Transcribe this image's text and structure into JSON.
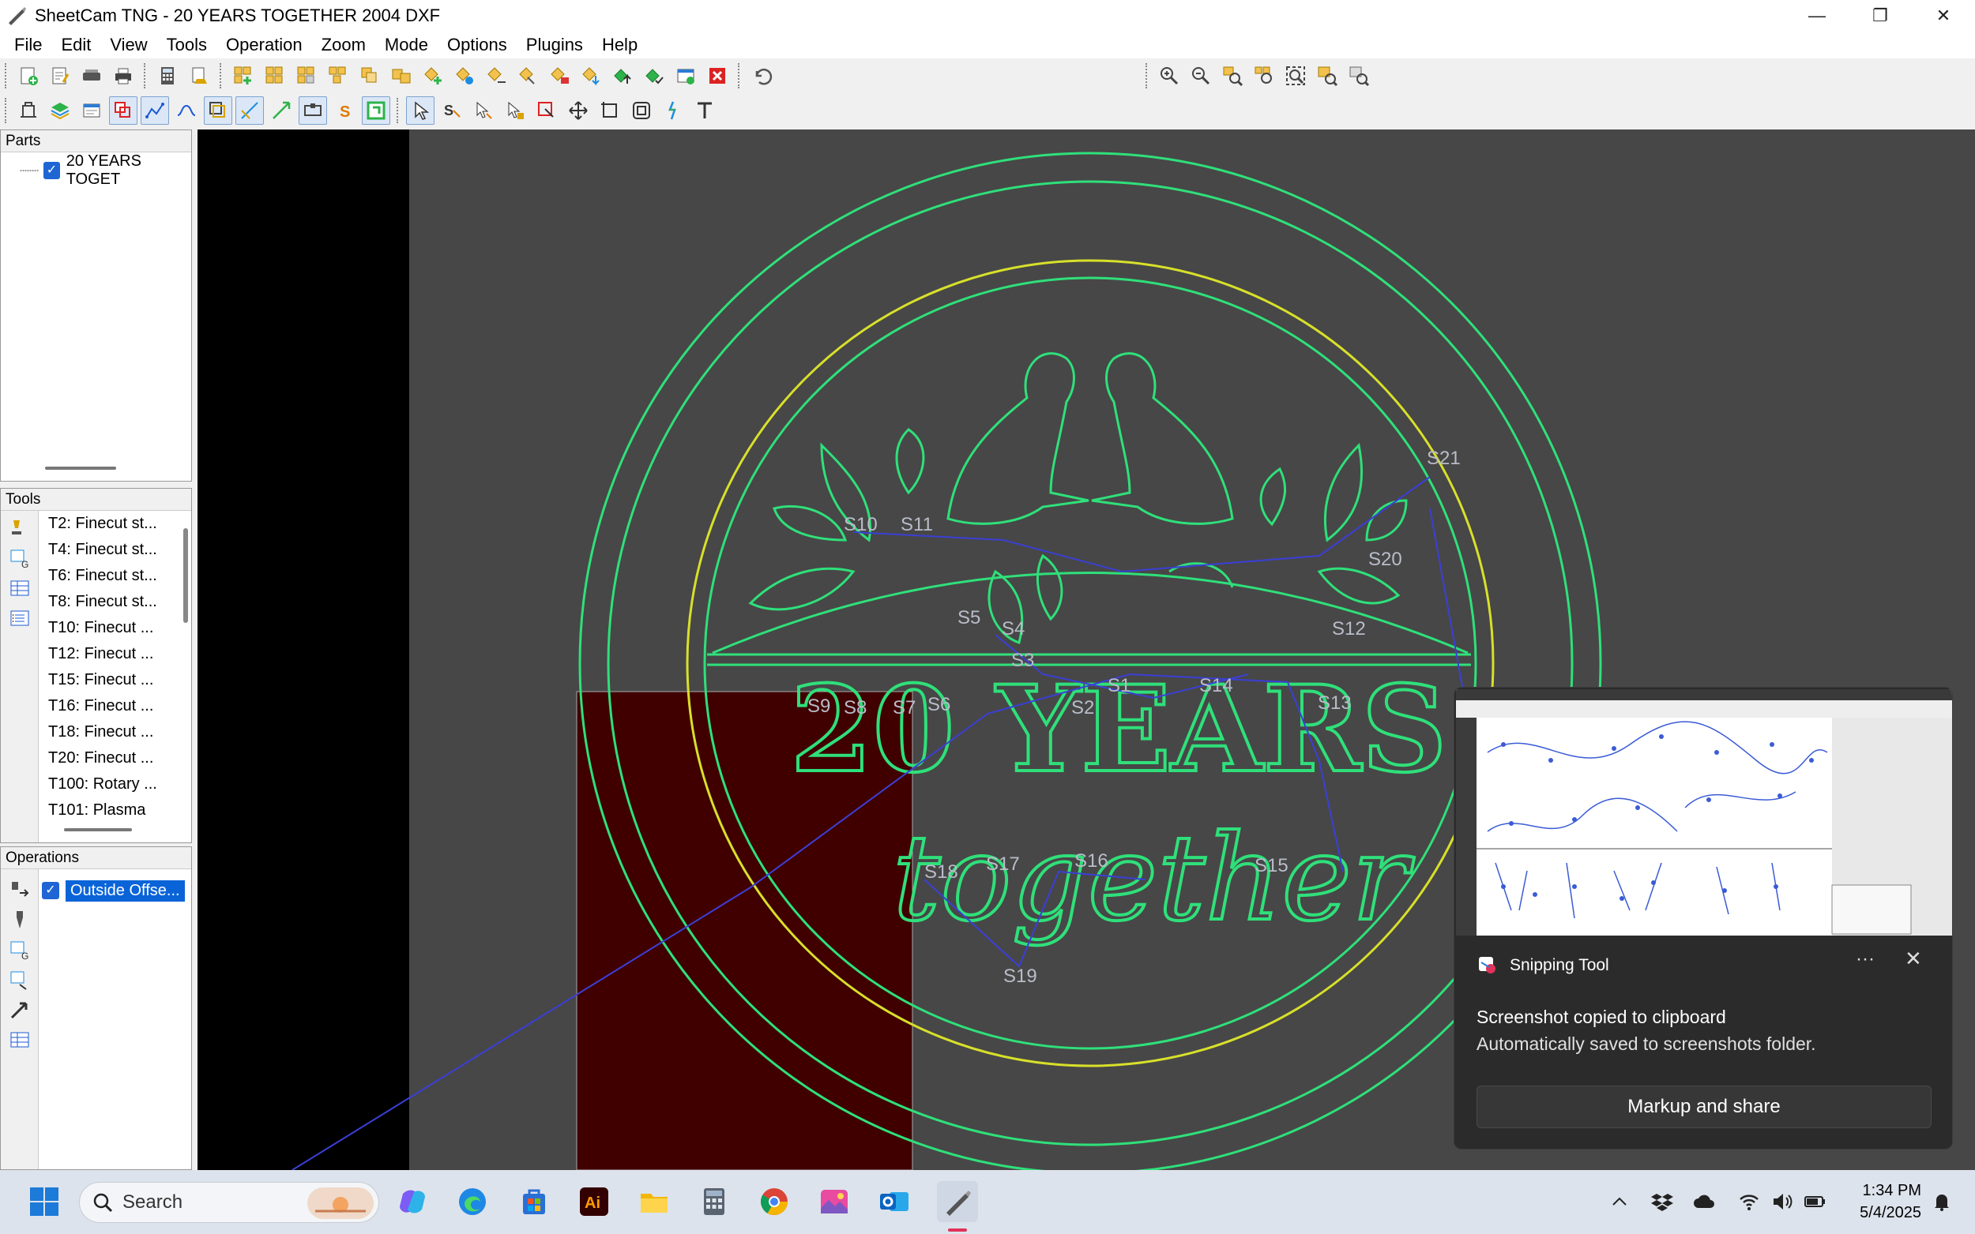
{
  "window": {
    "title": "SheetCam TNG - 20 YEARS TOGETHER 2004 DXF",
    "minimize": "—",
    "maximize": "❐",
    "close": "✕"
  },
  "menu": [
    "File",
    "Edit",
    "View",
    "Tools",
    "Operation",
    "Zoom",
    "Mode",
    "Options",
    "Plugins",
    "Help"
  ],
  "parts_panel": {
    "header": "Parts",
    "items": [
      {
        "label": "20 YEARS TOGET",
        "checked": true
      }
    ]
  },
  "tools_panel": {
    "header": "Tools",
    "items": [
      "T2: Finecut st...",
      "T4: Finecut st...",
      "T6: Finecut st...",
      "T8: Finecut st...",
      "T10: Finecut ...",
      "T12: Finecut ...",
      "T15: Finecut ...",
      "T16: Finecut ...",
      "T18: Finecut ...",
      "T20: Finecut ...",
      "T100: Rotary ...",
      "T101: Plasma"
    ]
  },
  "operations_panel": {
    "header": "Operations",
    "items": [
      {
        "label": "Outside Offse...",
        "checked": true
      }
    ]
  },
  "canvas": {
    "path_labels": [
      "S21",
      "S10",
      "S11",
      "S20",
      "S5",
      "S4",
      "S12",
      "S3",
      "S1",
      "S14",
      "S9",
      "S8",
      "S7",
      "S6",
      "S2",
      "S13",
      "S18",
      "S17",
      "S16",
      "S15",
      "S19"
    ],
    "artwork_text": {
      "line1": "20 YEARS",
      "line2": "together"
    },
    "colors": {
      "background": "#474747",
      "black_area": "#000000",
      "plate": "#400000",
      "outline_green": "#2fe07a",
      "outline_yellow": "#d8e02a",
      "rapid_blue": "#3b3fd6"
    }
  },
  "snipping_tool": {
    "app_name": "Snipping Tool",
    "more": "···",
    "close": "✕",
    "message_line1": "Screenshot copied to clipboard",
    "message_line2": "Automatically saved to screenshots folder.",
    "button": "Markup and share"
  },
  "taskbar": {
    "search_label": "Search",
    "time": "1:34 PM",
    "date": "5/4/2025",
    "apps": [
      "start-icon",
      "copilot-icon",
      "edge-icon",
      "store-icon",
      "illustrator-icon",
      "file-explorer-icon",
      "calculator-icon",
      "chrome-icon",
      "photos-icon",
      "outlook-icon",
      "sheetcam-icon"
    ]
  }
}
